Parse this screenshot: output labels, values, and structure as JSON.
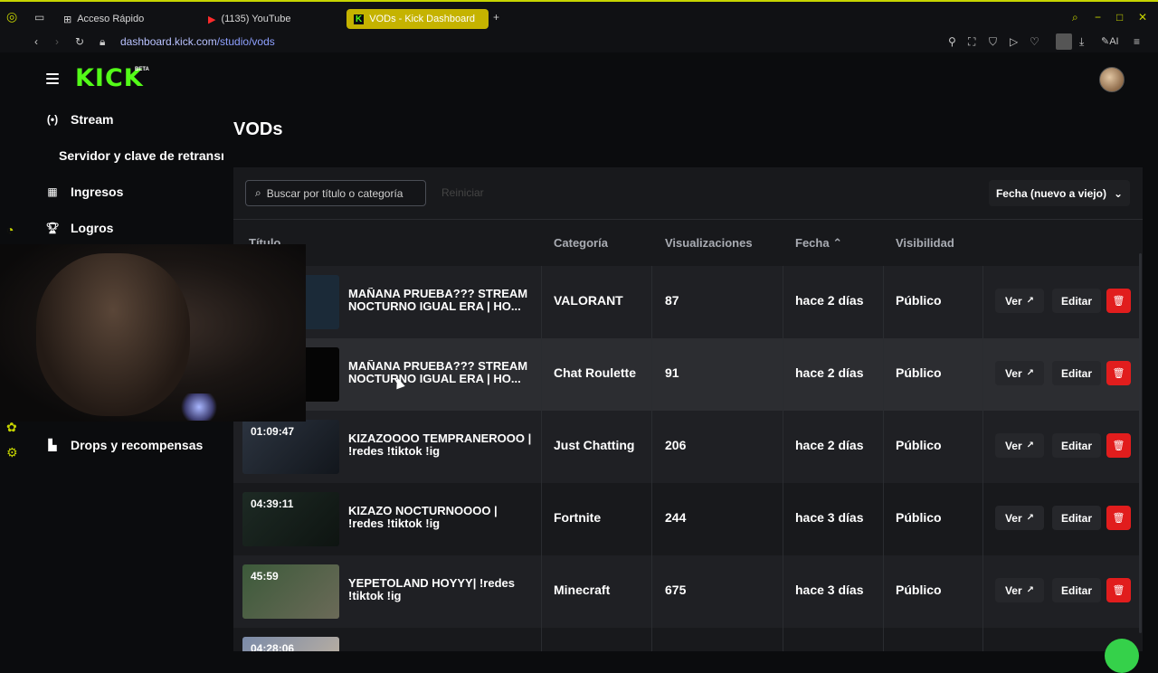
{
  "browser": {
    "tabs": [
      {
        "label": "Acceso Rápido",
        "icon": "grid-icon"
      },
      {
        "label": "(1135) YouTube",
        "icon": "youtube-icon"
      },
      {
        "label": "VODs - Kick Dashboard",
        "icon": "kick-icon"
      }
    ],
    "url_domain": "dashboard.kick.com",
    "url_path": "/studio/vods",
    "ai_label": "AI"
  },
  "sidebar": {
    "logo": "KICK",
    "beta": "BETA",
    "items": [
      {
        "label": "Stream",
        "icon": "broadcast-icon"
      },
      {
        "label": "Servidor y clave de retransmisión"
      },
      {
        "label": "Ingresos",
        "icon": "chart-icon"
      },
      {
        "label": "Logros",
        "icon": "trophy-icon"
      },
      {
        "label": "Drops y recompensas",
        "icon": "drops-icon"
      }
    ]
  },
  "page": {
    "title": "VODs",
    "search_placeholder": "Buscar por título o categoría",
    "reset": "Reiniciar",
    "sort": "Fecha (nuevo a viejo)"
  },
  "table": {
    "headers": [
      "Título",
      "Categoría",
      "Visualizaciones",
      "Fecha",
      "Visibilidad"
    ],
    "ver_label": "Ver",
    "edit_label": "Editar",
    "rows": [
      {
        "duration": "",
        "title": "MAÑANA PRUEBA??? STREAM NOCTURNO IGUAL ERA | HO...",
        "category": "VALORANT",
        "views": "87",
        "date": "hace 2 días",
        "visibility": "Público"
      },
      {
        "duration": "",
        "title": "MAÑANA PRUEBA??? STREAM NOCTURNO IGUAL ERA | HO...",
        "category": "Chat Roulette",
        "views": "91",
        "date": "hace 2 días",
        "visibility": "Público"
      },
      {
        "duration": "01:09:47",
        "title": "KIZAZOOOO TEMPRANEROOO | !redes !tiktok !ig",
        "category": "Just Chatting",
        "views": "206",
        "date": "hace 2 días",
        "visibility": "Público"
      },
      {
        "duration": "04:39:11",
        "title": "KIZAZO NOCTURNOOOO | !redes !tiktok !ig",
        "category": "Fortnite",
        "views": "244",
        "date": "hace 3 días",
        "visibility": "Público"
      },
      {
        "duration": "45:59",
        "title": "YEPETOLAND HOYYY| !redes !tiktok !ig",
        "category": "Minecraft",
        "views": "675",
        "date": "hace 3 días",
        "visibility": "Público"
      },
      {
        "duration": "04:28:06",
        "title": "",
        "category": "",
        "views": "",
        "date": "",
        "visibility": ""
      }
    ]
  },
  "colors": {
    "accent": "#53fc18",
    "danger": "#e11d1d",
    "active_tab": "#c5b300"
  }
}
